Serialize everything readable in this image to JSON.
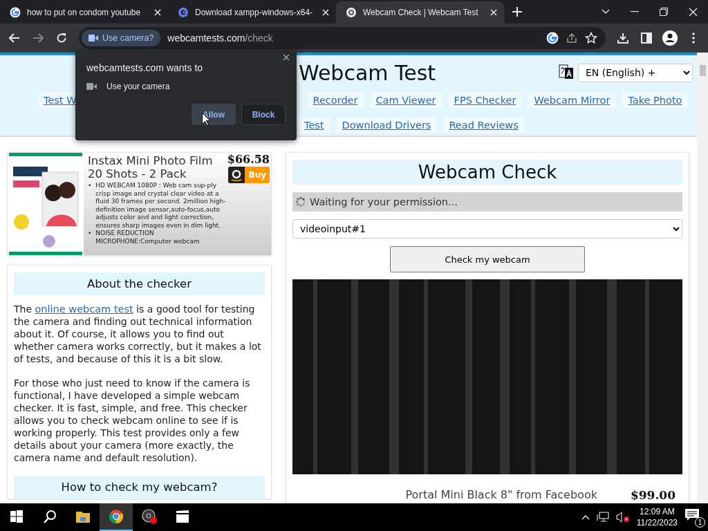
{
  "browser": {
    "tabs": [
      {
        "kind": "google",
        "title": "how to put on condom youtube",
        "selected": false
      },
      {
        "kind": "xampp",
        "title": "Download xampp-windows-x64-",
        "selected": false
      },
      {
        "kind": "webcam",
        "title": "Webcam Check | Webcam Test",
        "selected": true
      }
    ],
    "permission_chip": "Use camera?",
    "url_host": "webcamtests.com",
    "url_path": "/check"
  },
  "permission_popup": {
    "title": "webcamtests.com wants to",
    "permission": "Use your camera",
    "buttons": [
      {
        "label": "Allow",
        "hovered": true
      },
      {
        "label": "Block",
        "hovered": false
      }
    ]
  },
  "header": {
    "title": "Webcam Test",
    "language": "EN (English) +",
    "nav_row_1": [
      "Test W",
      "Recorder",
      "Cam Viewer",
      "FPS Checker",
      "Webcam Mirror",
      "Take Photo"
    ],
    "nav_row_2": [
      "Test",
      "Download Drivers",
      "Read Reviews"
    ]
  },
  "ad": {
    "title": "Instax Mini Photo Film 20 Shots - 2 Pack",
    "price": "$66.58",
    "buy": "Buy",
    "bullet": "•",
    "bullets": [
      "HD WEBCAM 1080P : Web cam sup-ply crisp image and crystal clear video at a fluid 30 frames per second. 2million high-definition image sensor,auto-focus,auto adjusts color and and light correction, ensures sharp images even in dim light.",
      "NOISE REDUCTION MICROPHONE:Computer webcam"
    ]
  },
  "about": {
    "heading": "About the checker",
    "intro_before": "The ",
    "intro_link": "online webcam test",
    "intro_after": " is a good tool for testing the camera and finding out technical information about it. Of course, it allows you to find out whether camera works correctly, but it makes a lot of tests, and because of this it is a bit slow.",
    "paragraph_2": "For those who just need to know if the camera is functional, I have developed a simple webcam checker. It is fast, simple, and free. This checker allows you to check webcam online to see if is working properly. This test provides only a few details about your camera (more exactly, the camera name and default resolution).",
    "next_heading": "How to check my webcam?"
  },
  "check": {
    "heading": "Webcam Check",
    "status": "Waiting for your permission...",
    "device": "videoinput#1",
    "button": "Check my webcam",
    "ad_title": "Portal Mini Black 8\" from Facebook",
    "ad_price": "$99.00"
  },
  "taskbar": {
    "apps": [
      {
        "kind": "start",
        "active": false
      },
      {
        "kind": "search",
        "active": false
      },
      {
        "kind": "explorer",
        "active": false
      },
      {
        "kind": "chrome",
        "active": true
      },
      {
        "kind": "obs",
        "active": false
      },
      {
        "kind": "clapper",
        "active": false
      }
    ],
    "time": "12:09 AM",
    "date": "11/22/2023",
    "notifications": "1"
  }
}
